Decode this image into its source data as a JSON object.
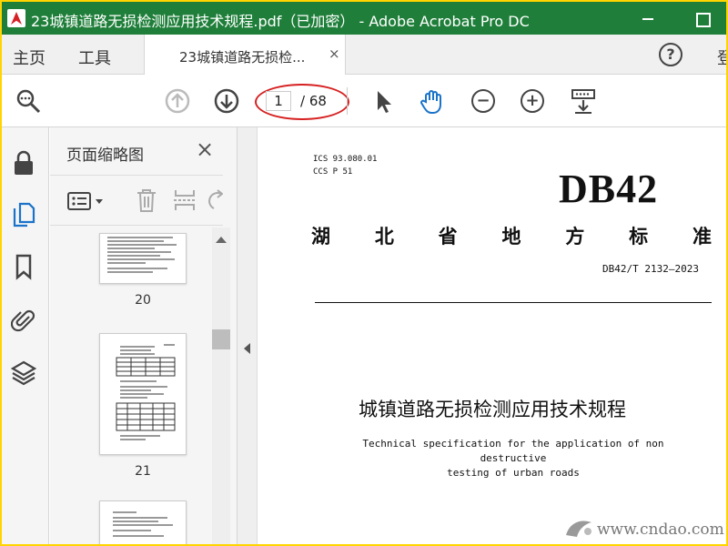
{
  "window": {
    "title": "23城镇道路无损检测应用技术规程.pdf（已加密） - Adobe Acrobat Pro DC"
  },
  "tabs": {
    "home": "主页",
    "tools": "工具",
    "document": "23城镇道路无损检...",
    "close": "×",
    "help": "?",
    "signin": "登"
  },
  "toolbar": {
    "current_page": "1",
    "total_pages": "/ 68",
    "zoom_in": "+",
    "zoom_out": "−"
  },
  "rail": {
    "icons": [
      "lock-icon",
      "pages-icon",
      "bookmark-icon",
      "attachment-icon",
      "layers-icon"
    ]
  },
  "thumbnails": {
    "panel_title": "页面缩略图",
    "close": "×",
    "pages": [
      {
        "label": "20"
      },
      {
        "label": "21"
      }
    ]
  },
  "document": {
    "ics": "ICS  93.080.01",
    "ccs": "CCS  P 51",
    "code": "DB42",
    "standard_chars": [
      "湖",
      "北",
      "省",
      "地",
      "方",
      "标",
      "准"
    ],
    "standard_no": "DB42/T 2132—2023",
    "title_zh": "城镇道路无损检测应用技术规程",
    "title_en_line1": "Technical specification for the application of non destructive",
    "title_en_line2": "testing of urban roads"
  },
  "watermark": {
    "text": "www.cndao.com"
  },
  "colors": {
    "titlebar": "#1f7f3a",
    "frame_border": "#ffd400",
    "highlight_oval": "#d62020",
    "hand_tool": "#1a73c9"
  }
}
